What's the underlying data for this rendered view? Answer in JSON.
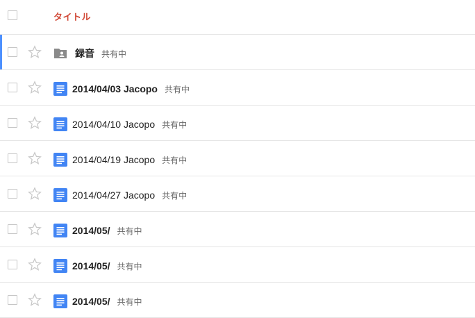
{
  "header": {
    "title": "タイトル"
  },
  "colors": {
    "header_title": "#d14836",
    "doc_icon": "#4285f4",
    "folder_icon": "#8a8a8a",
    "selected_bar": "#4d90fe"
  },
  "rows": [
    {
      "name": "録音",
      "shared": "共有中",
      "type": "shared-folder-icon",
      "bold": true
    },
    {
      "name": "2014/04/03 Jacopo",
      "shared": "共有中",
      "type": "document-icon",
      "bold": true
    },
    {
      "name": "2014/04/10 Jacopo",
      "shared": "共有中",
      "type": "document-icon",
      "bold": false
    },
    {
      "name": "2014/04/19 Jacopo",
      "shared": "共有中",
      "type": "document-icon",
      "bold": false
    },
    {
      "name": "2014/04/27 Jacopo",
      "shared": "共有中",
      "type": "document-icon",
      "bold": false
    },
    {
      "name": "2014/05/",
      "shared": "共有中",
      "type": "document-icon",
      "bold": true
    },
    {
      "name": "2014/05/",
      "shared": "共有中",
      "type": "document-icon",
      "bold": true
    },
    {
      "name": "2014/05/",
      "shared": "共有中",
      "type": "document-icon",
      "bold": true
    }
  ]
}
